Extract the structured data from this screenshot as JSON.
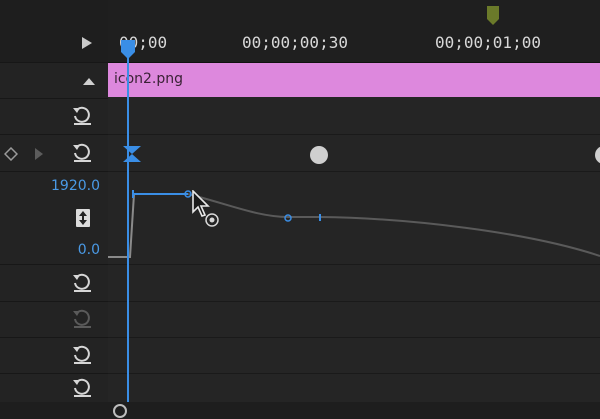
{
  "ruler": {
    "timecodes": [
      "00;00",
      "00;00;00;30",
      "00;00;01;00"
    ]
  },
  "clip": {
    "name": "icon2.png"
  },
  "value_graph": {
    "max_label": "1920.0",
    "min_label": "0.0"
  },
  "icons": {
    "play": "play-triangle-icon",
    "collapse": "collapse-up-icon",
    "reset": "reset-icon",
    "keyframe_nav": "keyframe-nav-icon",
    "vertical_scale": "vertical-scale-icon",
    "cursor": "cursor-icon",
    "playhead": "playhead-icon"
  },
  "colors": {
    "clip": "#dd88dd",
    "playhead": "#3a8ee6",
    "value_label": "#4a9ae6",
    "in_marker": "#6b7a2a"
  }
}
